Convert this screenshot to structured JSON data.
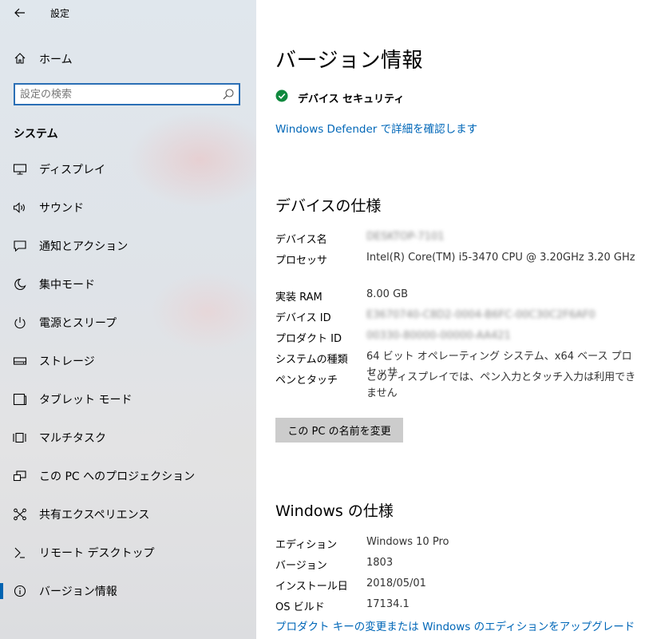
{
  "window": {
    "title": "設定"
  },
  "sidebar": {
    "home_label": "ホーム",
    "search_placeholder": "設定の検索",
    "section_title": "システム",
    "items": [
      {
        "label": "ディスプレイ",
        "icon": "display-icon"
      },
      {
        "label": "サウンド",
        "icon": "speaker-icon"
      },
      {
        "label": "通知とアクション",
        "icon": "notification-icon"
      },
      {
        "label": "集中モード",
        "icon": "moon-icon"
      },
      {
        "label": "電源とスリープ",
        "icon": "power-icon"
      },
      {
        "label": "ストレージ",
        "icon": "storage-icon"
      },
      {
        "label": "タブレット モード",
        "icon": "tablet-icon"
      },
      {
        "label": "マルチタスク",
        "icon": "multitask-icon"
      },
      {
        "label": "この PC へのプロジェクション",
        "icon": "projection-icon"
      },
      {
        "label": "共有エクスペリエンス",
        "icon": "share-icon"
      },
      {
        "label": "リモート デスクトップ",
        "icon": "remote-desktop-icon"
      },
      {
        "label": "バージョン情報",
        "icon": "info-icon",
        "selected": true
      }
    ]
  },
  "main": {
    "title": "バージョン情報",
    "security": {
      "label": "デバイス セキュリティ",
      "link": "Windows Defender で詳細を確認します"
    },
    "device_specs": {
      "heading": "デバイスの仕様",
      "rows": [
        {
          "label": "デバイス名",
          "value": "DESKTOP-7101",
          "blurred": true
        },
        {
          "label": "プロセッサ",
          "value": "Intel(R) Core(TM) i5-3470 CPU @ 3.20GHz   3.20 GHz"
        },
        {
          "label": "実装 RAM",
          "value": "8.00 GB"
        },
        {
          "label": "デバイス ID",
          "value": "E3670740-C8D2-0004-B6FC-00C30C2F6AF0",
          "blurred": true
        },
        {
          "label": "プロダクト ID",
          "value": "00330-80000-00000-AA421",
          "blurred": true
        },
        {
          "label": "システムの種類",
          "value": "64 ビット オペレーティング システム、x64 ベース プロセッサ"
        },
        {
          "label": "ペンとタッチ",
          "value": "このディスプレイでは、ペン入力とタッチ入力は利用できません"
        }
      ],
      "rename_button": "この PC の名前を変更"
    },
    "windows_specs": {
      "heading": "Windows の仕様",
      "rows": [
        {
          "label": "エディション",
          "value": "Windows 10 Pro"
        },
        {
          "label": "バージョン",
          "value": "1803"
        },
        {
          "label": "インストール日",
          "value": "2018/05/01"
        },
        {
          "label": "OS ビルド",
          "value": "17134.1"
        }
      ],
      "upgrade_link": "プロダクト キーの変更または Windows のエディションをアップグレード"
    }
  },
  "colors": {
    "accent": "#0063b1",
    "link": "#0067b8",
    "check": "#10893e",
    "button_bg": "#cccccc"
  }
}
